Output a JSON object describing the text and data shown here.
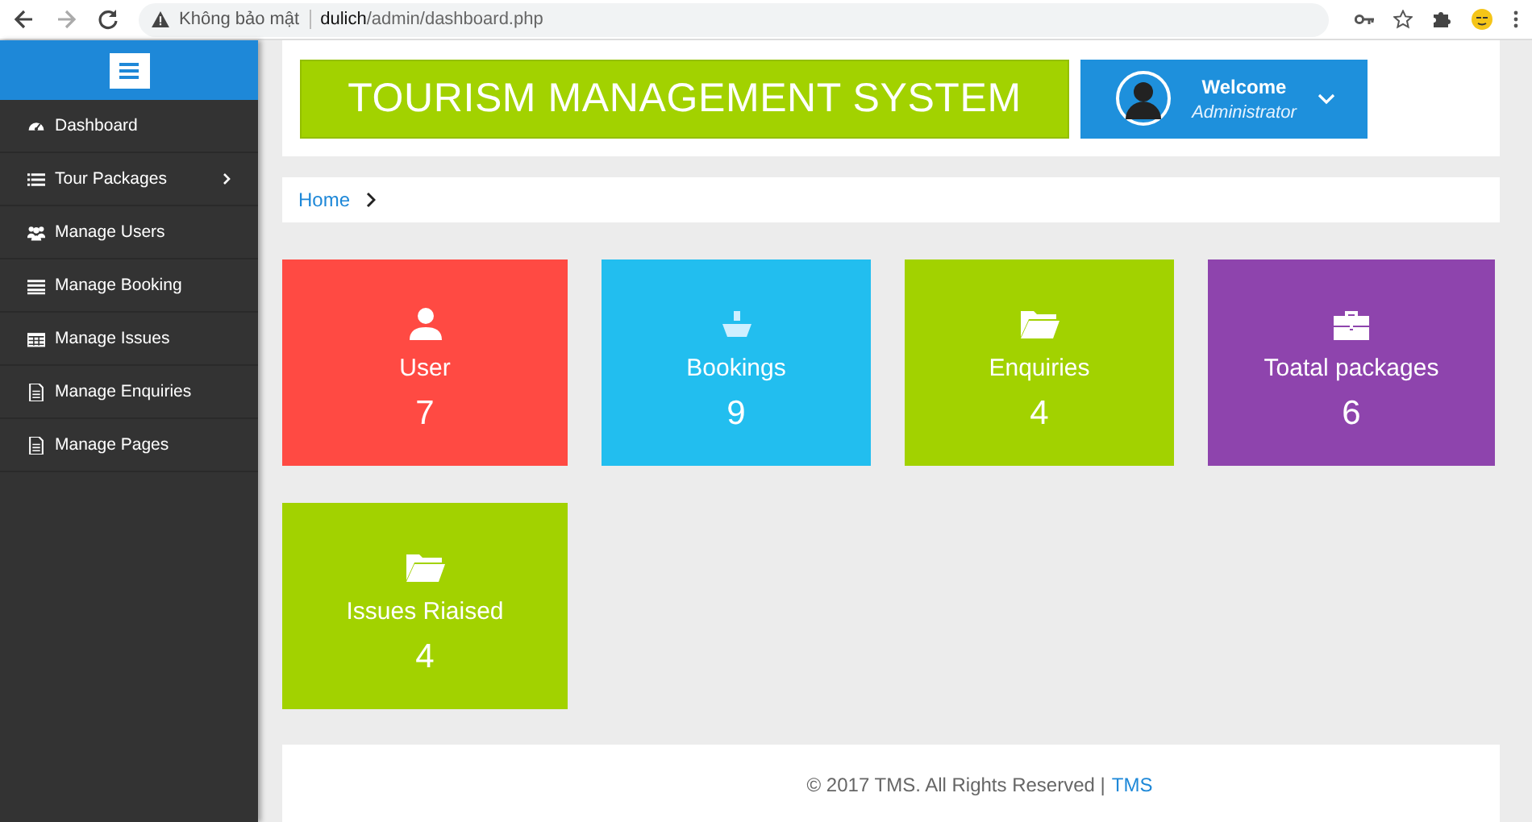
{
  "browser": {
    "security": "Không bảo mật",
    "url": "**dulich**/admin/dashboard.php"
  },
  "sidebar": {
    "items": [
      {
        "label": "Dashboard",
        "submenu": false
      },
      {
        "label": "Tour Packages",
        "submenu": true
      },
      {
        "label": "Manage Users",
        "submenu": false
      },
      {
        "label": "Manage Booking",
        "submenu": false
      },
      {
        "label": "Manage Issues",
        "submenu": false
      },
      {
        "label": "Manage Enquiries",
        "submenu": false
      },
      {
        "label": "Manage Pages",
        "submenu": false
      }
    ]
  },
  "header": {
    "title": "TOURISM MANAGEMENT SYSTEM",
    "welcome": "Welcome",
    "role": "Administrator"
  },
  "breadcrumb": [
    "Home"
  ],
  "cards": [
    {
      "label": "User",
      "count": "7",
      "color": "#ff4a43"
    },
    {
      "label": "Bookings",
      "count": "9",
      "color": "#22beef"
    },
    {
      "label": "Enquiries",
      "count": "4",
      "color": "#a2d200"
    },
    {
      "label": "Toatal packages",
      "count": "6",
      "color": "#8e44ad"
    },
    {
      "label": "Issues Riaised",
      "count": "4",
      "color": "#a2d200"
    }
  ],
  "footer": {
    "text": "© 2017 TMS. All Rights Reserved |",
    "link": "TMS"
  }
}
